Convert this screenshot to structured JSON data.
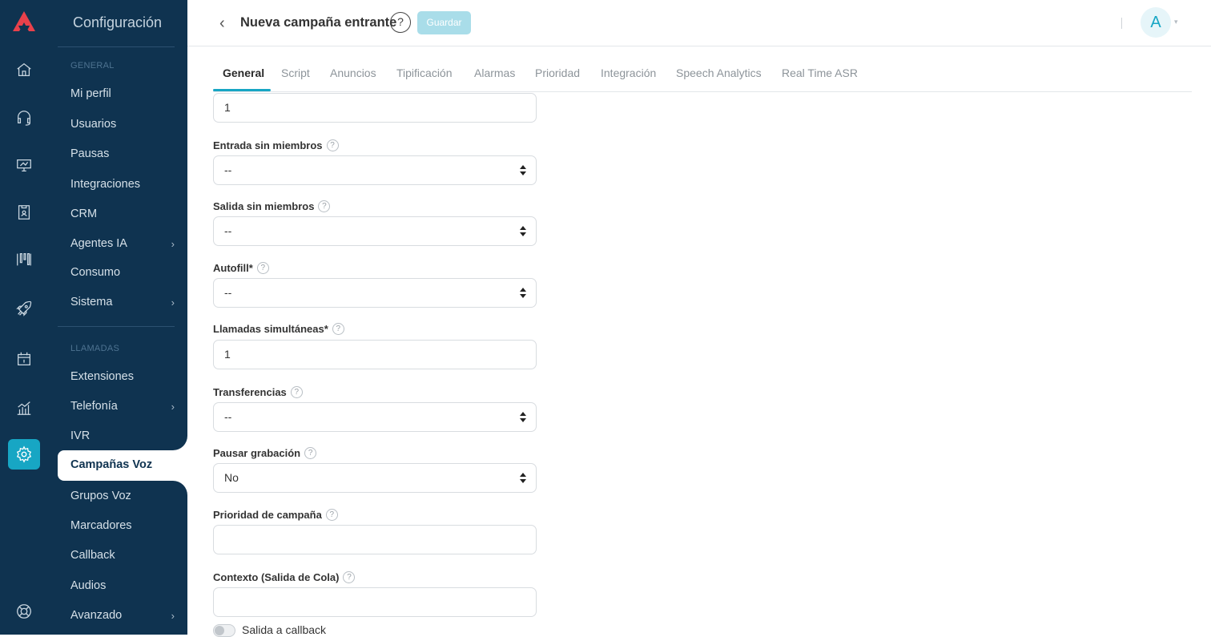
{
  "sidebar": {
    "title": "Configuración",
    "sections": [
      {
        "label": "GENERAL"
      },
      {
        "label": "LLAMADAS"
      }
    ],
    "general_items": [
      {
        "label": "Mi perfil",
        "has_children": false
      },
      {
        "label": "Usuarios",
        "has_children": false
      },
      {
        "label": "Pausas",
        "has_children": false
      },
      {
        "label": "Integraciones",
        "has_children": false
      },
      {
        "label": "CRM",
        "has_children": false
      },
      {
        "label": "Agentes IA",
        "has_children": true
      },
      {
        "label": "Consumo",
        "has_children": false
      },
      {
        "label": "Sistema",
        "has_children": true
      }
    ],
    "calls_items": [
      {
        "label": "Extensiones",
        "has_children": false
      },
      {
        "label": "Telefonía",
        "has_children": true
      },
      {
        "label": "IVR",
        "has_children": false
      },
      {
        "label": "Campañas Voz",
        "has_children": false,
        "active": true
      },
      {
        "label": "Grupos Voz",
        "has_children": false
      },
      {
        "label": "Marcadores",
        "has_children": false
      },
      {
        "label": "Callback",
        "has_children": false
      },
      {
        "label": "Audios",
        "has_children": false
      },
      {
        "label": "Avanzado",
        "has_children": true
      }
    ],
    "chevron": "›"
  },
  "rail_icons": [
    "logo-icon",
    "home-icon",
    "headset-icon",
    "monitor-icon",
    "contacts-icon",
    "kanban-icon",
    "rocket-icon",
    "calendar-icon",
    "analytics-icon",
    "settings-icon",
    "support-icon"
  ],
  "header": {
    "back": "‹",
    "title": "Nueva campaña entrante",
    "help": "?",
    "save_label": "Guardar",
    "avatar_initial": "A",
    "avatar_caret": "▾"
  },
  "tabs": [
    "General",
    "Script",
    "Anuncios",
    "Tipificación",
    "Alarmas",
    "Prioridad",
    "Integración",
    "Speech Analytics",
    "Real Time ASR"
  ],
  "active_tab": "General",
  "form": {
    "top_field_value": "1",
    "fields": [
      {
        "label": "Entrada sin miembros",
        "type": "select",
        "value": "--"
      },
      {
        "label": "Salida sin miembros",
        "type": "select",
        "value": "--"
      },
      {
        "label": "Autofill*",
        "type": "select",
        "value": "--"
      },
      {
        "label": "Llamadas simultáneas*",
        "type": "input",
        "value": "1"
      },
      {
        "label": "Transferencias",
        "type": "select",
        "value": "--"
      },
      {
        "label": "Pausar grabación",
        "type": "select",
        "value": "No"
      },
      {
        "label": "Prioridad de campaña",
        "type": "input",
        "value": ""
      },
      {
        "label": "Contexto (Salida de Cola)",
        "type": "input",
        "value": ""
      }
    ],
    "help_glyph": "?",
    "toggle_label": "Salida a callback",
    "toggle_on": false
  },
  "colors": {
    "sidebar_bg": "#0f3350",
    "accent": "#17a6c4",
    "save_button_disabled": "#a9dde9"
  }
}
